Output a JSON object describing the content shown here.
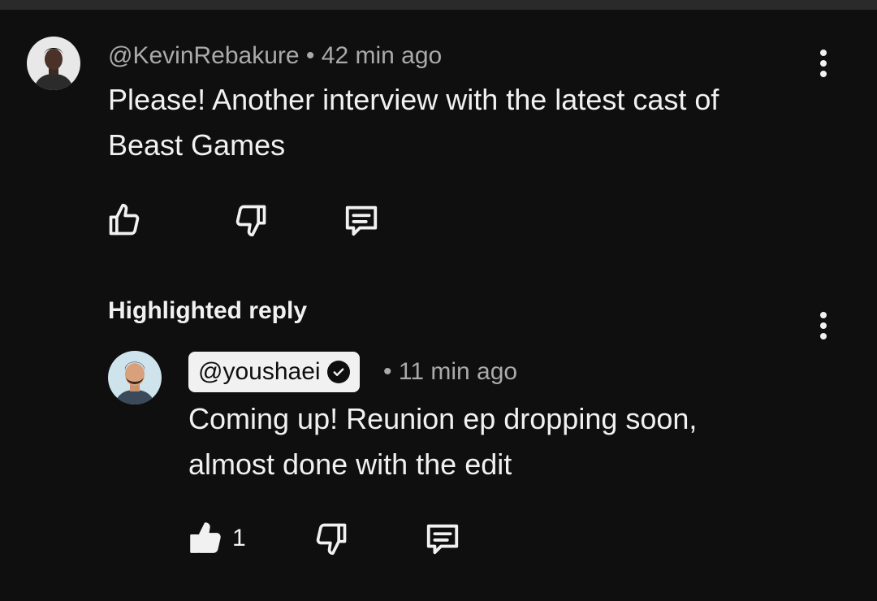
{
  "comment": {
    "author": "@KevinRebakure",
    "separator": "•",
    "time": "42 min ago",
    "text_line1": "Please! Another interview with the latest cast of",
    "text_line2": "Beast Games",
    "icons": {
      "like": "thumbs-up-outline-icon",
      "dislike": "thumbs-down-outline-icon",
      "reply": "reply-bubble-icon",
      "menu": "more-vert-icon"
    }
  },
  "reply": {
    "label": "Highlighted reply",
    "author": "@youshaei",
    "verified_icon": "verified-check-icon",
    "separator": "•",
    "time": "11 min ago",
    "text_line1": "Coming up! Reunion ep dropping soon,",
    "text_line2": "almost done with the edit",
    "like_count": "1",
    "icons": {
      "like": "thumbs-up-filled-icon",
      "dislike": "thumbs-down-outline-icon",
      "reply": "reply-bubble-icon",
      "menu": "more-vert-icon"
    }
  },
  "colors": {
    "background": "#0f0f0f",
    "text_primary": "#f1f1f1",
    "text_secondary": "#aaaaaa"
  }
}
